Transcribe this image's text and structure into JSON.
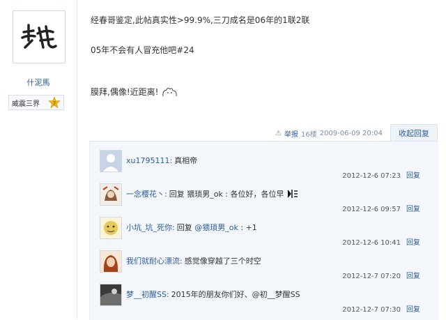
{
  "author": {
    "username": "什泥馬",
    "rank_title": "威震三界",
    "rank_level": "7"
  },
  "post": {
    "line1": "经春哥鉴定,此帖真实性>99.9%,三刀成名是06年的1联2联",
    "line2": "05年不会有人冒充他吧#24",
    "line3": "膜拜,偶像!近距离!"
  },
  "meta": {
    "report_label": "举报",
    "floor": "16楼",
    "datetime": "2009-06-09 20:04",
    "fold_label": "收起回复"
  },
  "comments": [
    {
      "user": "xu1795111:",
      "text": "真相帝",
      "time": "2012-12-6 07:23",
      "reply": "回复"
    },
    {
      "user": "一念樱花丶:",
      "text": "回复 猥琐男_ok : 各位好，各位早",
      "time": "2012-12-6 09:57",
      "reply": "回复"
    },
    {
      "user": "小坑_坑_死你:",
      "text_prefix": "回复 ",
      "mention": "@猥琐男_ok",
      "text_suffix": " : +1",
      "time": "2012-12-6 10:41",
      "reply": "回复"
    },
    {
      "user": "我们就耐心漂流:",
      "text": "感觉像穿越了三个时空",
      "time": "2012-12-7 07:20",
      "reply": "回复"
    },
    {
      "user": "梦__初醒SS:",
      "text": "2015年的朋友你们好、@初__梦醒SS",
      "time": "2012-12-7 07:30",
      "reply": "回复"
    }
  ]
}
